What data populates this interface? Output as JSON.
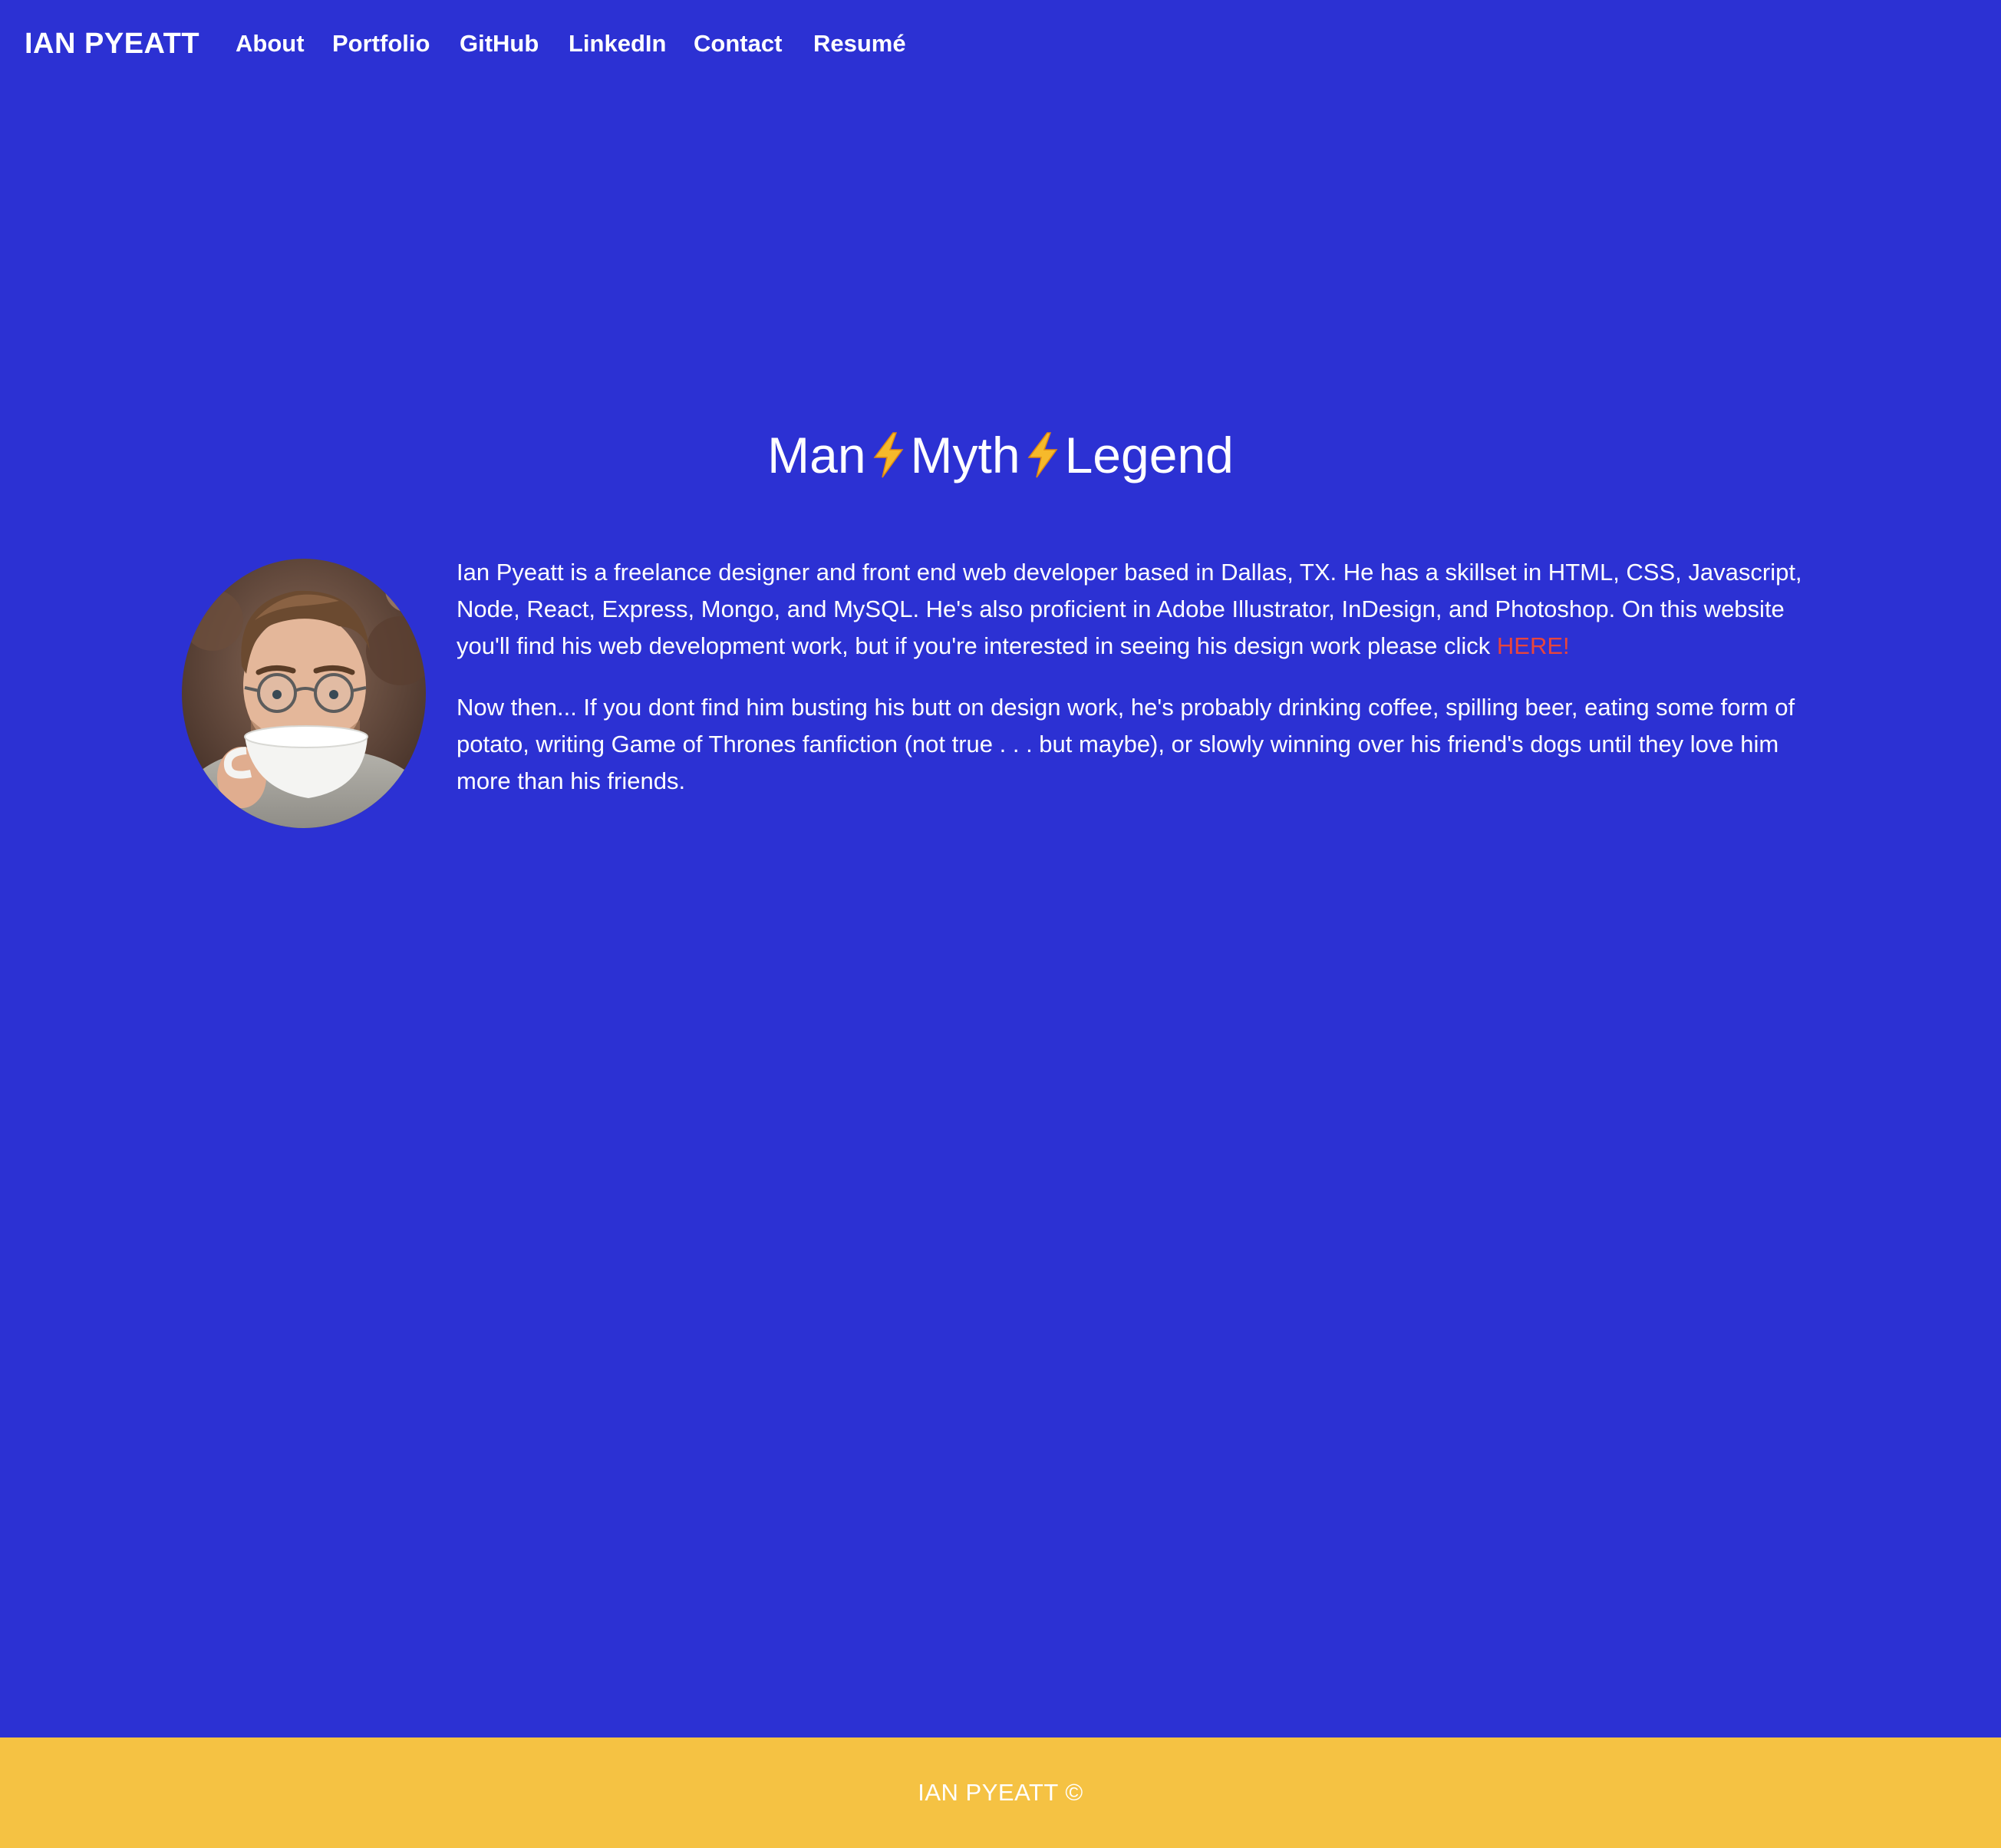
{
  "nav": {
    "brand": "IAN PYEATT",
    "links": [
      {
        "label": "About"
      },
      {
        "label": "Portfolio"
      },
      {
        "label": "GitHub"
      },
      {
        "label": "LinkedIn"
      },
      {
        "label": "Contact"
      },
      {
        "label": "Resumé"
      }
    ]
  },
  "hero": {
    "title_parts": [
      "Man",
      "Myth",
      "Legend"
    ],
    "separator_icon": "lightning-bolt-emoji"
  },
  "bio": {
    "paragraph1_text": "Ian Pyeatt is a freelance designer and front end web developer based in Dallas, TX. He has a skillset in HTML, CSS, Javascript, Node, React, Express, Mongo, and MySQL. He's also proficient in Adobe Illustrator, InDesign, and Photoshop. On this website you'll find his web development work, but if you're interested in seeing his design work please click ",
    "paragraph1_link": "HERE!",
    "paragraph2": "Now then... If you dont find him busting his butt on design work, he's probably drinking coffee, spilling beer, eating some form of potato, writing Game of Thrones fanfiction (not true . . . but maybe), or slowly winning over his friend's dogs until they love him more than his friends."
  },
  "footer": {
    "text": "IAN PYEATT ©"
  },
  "colors": {
    "background": "#2c31d3",
    "footer": "#f5c243",
    "link_accent": "#e8453c",
    "text": "#ffffff"
  }
}
